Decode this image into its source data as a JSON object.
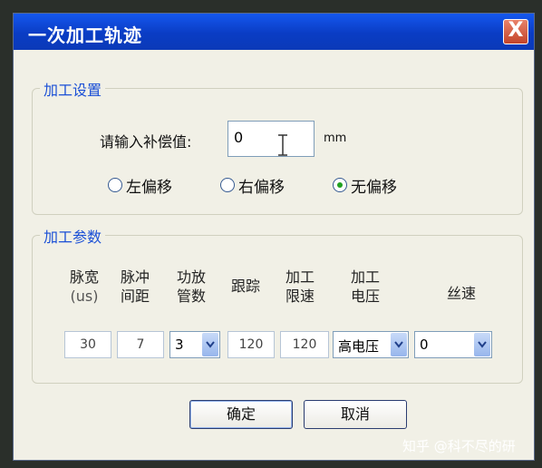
{
  "window": {
    "title": "一次加工轨迹",
    "close_label": "X"
  },
  "settings_group": {
    "legend": "加工设置",
    "offset_label": "请输入补偿值:",
    "offset_value": "0",
    "unit": "mm",
    "radios": [
      {
        "label": "左偏移",
        "checked": false
      },
      {
        "label": "右偏移",
        "checked": false
      },
      {
        "label": "无偏移",
        "checked": true
      }
    ]
  },
  "params_group": {
    "legend": "加工参数",
    "columns": [
      {
        "line1": "脉宽",
        "line2": "(us)",
        "value": "30"
      },
      {
        "line1": "脉冲",
        "line2": "间距",
        "value": "7"
      },
      {
        "line1": "功放",
        "line2": "管数",
        "value": "3"
      },
      {
        "line1": "跟踪",
        "line2": "",
        "value": "120"
      },
      {
        "line1": "加工",
        "line2": "限速",
        "value": "120"
      },
      {
        "line1": "加工",
        "line2": "电压",
        "value": "高电压"
      },
      {
        "line1": "丝速",
        "line2": "",
        "value": "0"
      }
    ]
  },
  "buttons": {
    "ok": "确定",
    "cancel": "取消"
  },
  "watermark": "知乎 @科不尽的研",
  "colors": {
    "title_bar": "#0a3cc4",
    "legend": "#1a4fd6",
    "dialog_bg": "#f1f0e6"
  }
}
